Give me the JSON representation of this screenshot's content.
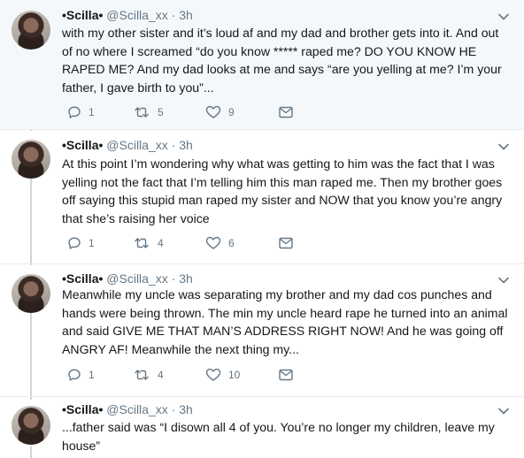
{
  "tweets": [
    {
      "name": "•Scilla•",
      "handle": "@Scilla_xx",
      "separator": "·",
      "time": "3h",
      "text": "with my other sister and it’s loud af and my dad and brother gets into it. And out of no where I screamed “do you know ***** raped me? DO YOU KNOW HE RAPED ME? And my dad looks at me and says “are you yelling at me? I’m your father, I gave birth to you”...",
      "replies": "1",
      "retweets": "5",
      "likes": "9"
    },
    {
      "name": "•Scilla•",
      "handle": "@Scilla_xx",
      "separator": "·",
      "time": "3h",
      "text": "At this point I’m wondering why what was getting to him was the fact that I was yelling not the fact that I’m telling him this man raped me. Then my brother goes off saying this stupid man raped my sister and NOW that you know you’re angry that she’s raising her voice",
      "replies": "1",
      "retweets": "4",
      "likes": "6"
    },
    {
      "name": "•Scilla•",
      "handle": "@Scilla_xx",
      "separator": "·",
      "time": "3h",
      "text": "Meanwhile my uncle was separating my brother and my dad cos punches and hands were being thrown. The min my uncle heard rape he turned into an animal and said GIVE ME THAT MAN’S ADDRESS RIGHT NOW! And he was going off ANGRY AF! Meanwhile the next thing my...",
      "replies": "1",
      "retweets": "4",
      "likes": "10"
    },
    {
      "name": "•Scilla•",
      "handle": "@Scilla_xx",
      "separator": "·",
      "time": "3h",
      "text": "...father said was “I disown all 4 of you. You’re no longer my children, leave my house”"
    }
  ],
  "icons": {
    "reply": "reply-icon",
    "retweet": "retweet-icon",
    "like": "heart-icon",
    "message": "envelope-icon",
    "menu": "chevron-down-icon"
  }
}
